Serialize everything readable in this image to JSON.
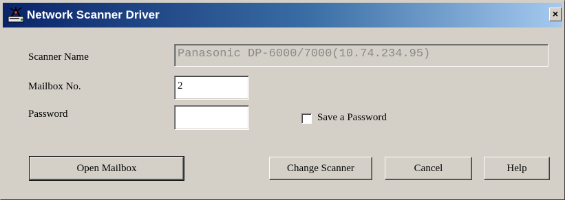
{
  "window": {
    "title": "Network Scanner Driver",
    "close_symbol": "×",
    "app_icon": "scanner-app-icon"
  },
  "form": {
    "scanner_name": {
      "label": "Scanner Name",
      "value": "Panasonic DP-6000/7000(10.74.234.95)"
    },
    "mailbox_no": {
      "label": "Mailbox No.",
      "value": "2"
    },
    "password": {
      "label": "Password",
      "value": ""
    },
    "save_password": {
      "label": "Save a Password",
      "checked": false
    }
  },
  "buttons": {
    "open_mailbox": "Open Mailbox",
    "change_scanner": "Change Scanner",
    "cancel": "Cancel",
    "help": "Help"
  },
  "colors": {
    "titlebar_start": "#0a246a",
    "titlebar_end": "#a6caf0",
    "face": "#d4d0c8"
  }
}
